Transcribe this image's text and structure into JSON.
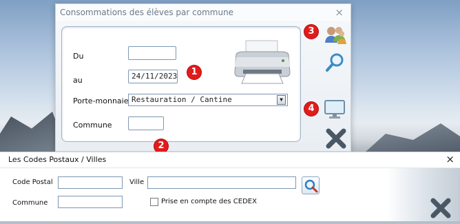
{
  "main_window": {
    "title": "Consommations des élèves par commune",
    "close_glyph": "×",
    "form": {
      "du_label": "Du",
      "du_value": "",
      "au_label": "au",
      "au_value": "24/11/2023",
      "porte_monnaie_label": "Porte-monnaie",
      "porte_monnaie_value": "Restauration / Cantine",
      "commune_label": "Commune",
      "commune_value": ""
    },
    "icons": [
      "printer-icon",
      "users-icon",
      "search-icon",
      "monitor-icon",
      "close-x-icon"
    ]
  },
  "badges": {
    "b1": "1",
    "b2": "2",
    "b3": "3",
    "b4": "4"
  },
  "bottom_window": {
    "title": "Les Codes Postaux / Villes",
    "close_glyph": "×",
    "code_postal_label": "Code Postal",
    "code_postal_value": "",
    "ville_label": "Ville",
    "ville_value": "",
    "commune_label": "Commune",
    "commune_value": "",
    "cedex_label": "Prise en compte des CEDEX",
    "cedex_checked": false
  },
  "colors": {
    "badge": "#e21b1b",
    "panel_border": "#9fb3c6",
    "close_x": "#4a5866"
  }
}
